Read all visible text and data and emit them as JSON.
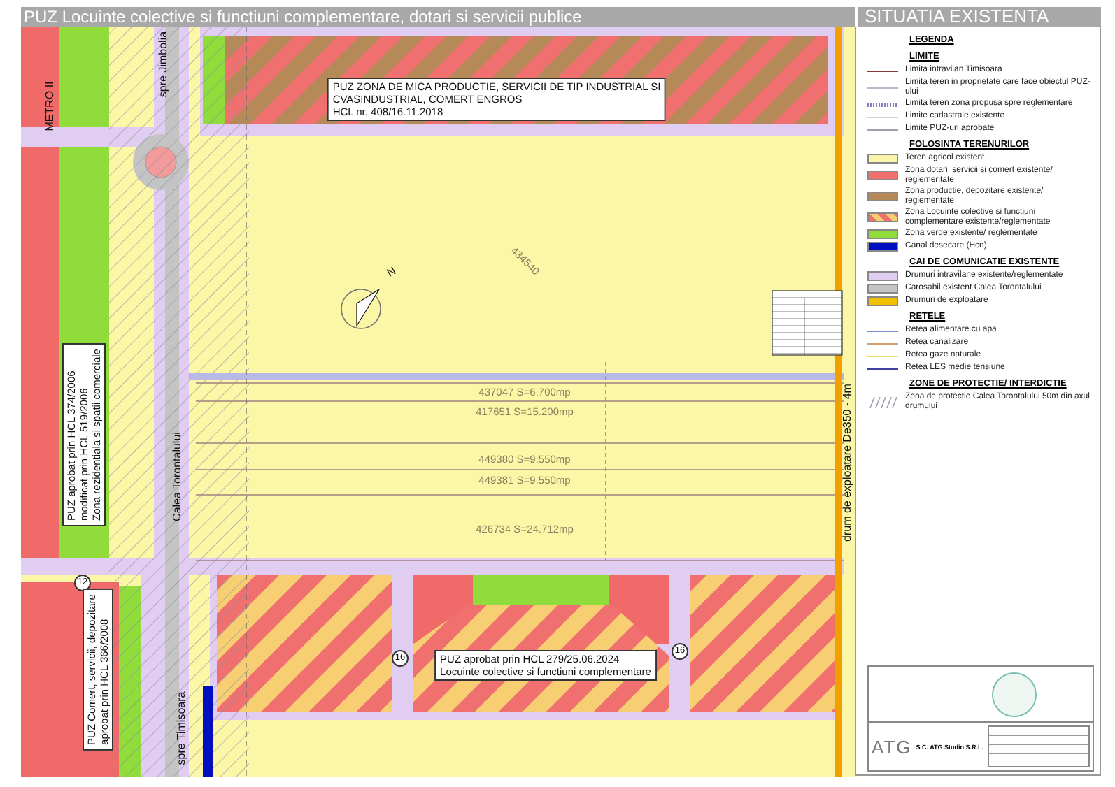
{
  "header": {
    "title": "PUZ Locuinte colective si functiuni complementare, dotari si servicii publice",
    "panel_title": "SITUATIA EXISTENTA"
  },
  "map": {
    "labels": [
      {
        "kind": "text",
        "lines": [
          "METRO II"
        ]
      },
      {
        "kind": "text",
        "lines": [
          "spre Jimbolia"
        ]
      },
      {
        "kind": "box",
        "lines": [
          "PUZ ZONA DE MICA PRODUCTIE, SERVICII DE TIP INDUSTRIAL SI",
          "CVASINDUSTRIAL, COMERT ENGROS",
          "HCL nr. 408/16.11.2018"
        ]
      },
      {
        "kind": "faint",
        "lines": [
          "434540"
        ]
      },
      {
        "kind": "box",
        "lines": [
          "PUZ aprobat prin HCL 374/2006",
          "modificat prin HCL 519/2006",
          "Zona rezidentiala si spatii comerciale"
        ]
      },
      {
        "kind": "text",
        "lines": [
          "Calea Torontalului"
        ]
      },
      {
        "kind": "faint",
        "lines": [
          "437047 S=6.700mp"
        ]
      },
      {
        "kind": "faint",
        "lines": [
          "417651 S=15.200mp"
        ]
      },
      {
        "kind": "faint",
        "lines": [
          "449380 S=9.550mp"
        ]
      },
      {
        "kind": "faint",
        "lines": [
          "449381 S=9.550mp"
        ]
      },
      {
        "kind": "faint",
        "lines": [
          "426734 S=24.712mp"
        ]
      },
      {
        "kind": "text",
        "lines": [
          "drum de exploatare De350 - 4m"
        ]
      },
      {
        "kind": "circle",
        "lines": [
          "12"
        ]
      },
      {
        "kind": "box",
        "lines": [
          "PUZ Comert, servicii, depozitare",
          "aprobat prin HCL 366/2008"
        ]
      },
      {
        "kind": "text",
        "lines": [
          "spre Timisoara"
        ]
      },
      {
        "kind": "circle",
        "lines": [
          "16"
        ]
      },
      {
        "kind": "circle",
        "lines": [
          "16"
        ]
      },
      {
        "kind": "box",
        "lines": [
          "PUZ aprobat prin HCL 279/25.06.2024",
          "Locuinte colective si functiuni complementare"
        ]
      },
      {
        "kind": "text",
        "lines": [
          "N"
        ]
      }
    ]
  },
  "legend": {
    "heading": "LEGENDA",
    "sections": [
      {
        "heading": "LIMITE",
        "items": [
          {
            "kind": "line",
            "color": "#8b3a3a",
            "label": "Limita intravilan Timisoara"
          },
          {
            "kind": "line",
            "color": "#b8b8c8",
            "label": "Limita teren in proprietate care face obiectul PUZ-ului"
          },
          {
            "kind": "dotted",
            "color": "#8080c0",
            "label": "Limita teren zona propusa spre reglementare"
          },
          {
            "kind": "line",
            "color": "#d0d0d0",
            "label": "Limite cadastrale existente"
          },
          {
            "kind": "line",
            "color": "#a0a0b0",
            "label": "Limite PUZ-uri aprobate"
          }
        ]
      },
      {
        "heading": "FOLOSINTA TERENURILOR",
        "items": [
          {
            "kind": "swatch",
            "color": "#fbf5a8",
            "label": "Teren agricol existent"
          },
          {
            "kind": "swatch",
            "color": "#f07070",
            "label": "Zona dotari, servicii si comert existente/ reglementate"
          },
          {
            "kind": "swatch",
            "color": "#b58a58",
            "label": "Zona productie, depozitare existente/ reglementate"
          },
          {
            "kind": "striped",
            "color": "#f07070",
            "label": "Zona Locuinte colective si functiuni complementare existente/reglementate"
          },
          {
            "kind": "swatch",
            "color": "#8fdc3a",
            "label": "Zona verde existente/ reglementate"
          },
          {
            "kind": "swatch",
            "color": "#0010c0",
            "label": "Canal desecare (Hcn)"
          }
        ]
      },
      {
        "heading": "CAI DE COMUNICATIE EXISTENTE",
        "items": [
          {
            "kind": "swatch",
            "color": "#e2cdf2",
            "label": "Drumuri intravilane existente/reglementate"
          },
          {
            "kind": "swatch",
            "color": "#c4c4c4",
            "label": "Carosabil existent Calea Torontalului"
          },
          {
            "kind": "swatch",
            "color": "#f2c000",
            "label": "Drumuri de exploatare"
          }
        ]
      },
      {
        "heading": "RETELE",
        "items": [
          {
            "kind": "line",
            "color": "#7090d0",
            "label": "Retea alimentare cu apa"
          },
          {
            "kind": "line",
            "color": "#d0a070",
            "label": "Retea canalizare"
          },
          {
            "kind": "line",
            "color": "#e8e070",
            "label": "Retea gaze naturale"
          },
          {
            "kind": "line",
            "color": "#4040a0",
            "label": "Retea LES medie tensiune"
          }
        ]
      },
      {
        "heading": "ZONE DE PROTECTIE/ INTERDICTIE",
        "items": [
          {
            "kind": "hatch",
            "color": "#a0a0b0",
            "label": "Zona de protectie Calea Torontalului 50m din axul drumului"
          }
        ]
      }
    ]
  },
  "title_block": {
    "logo": "ATG",
    "company": "S.C. ATG Studio S.R.L."
  }
}
